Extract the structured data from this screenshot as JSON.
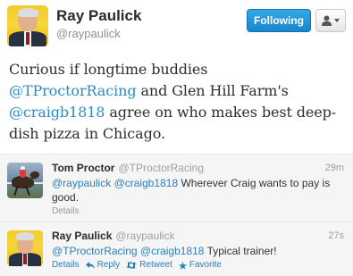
{
  "main_tweet": {
    "name": "Ray Paulick",
    "handle": "@raypaulick",
    "follow_label": "Following",
    "text_lines": [
      [
        {
          "t": "Curious if longtime buddies",
          "m": false
        }
      ],
      [
        {
          "t": "@TProctorRacing",
          "m": true
        },
        {
          "t": " and Glen Hill Farm's",
          "m": false
        }
      ],
      [
        {
          "t": "@craigb1818",
          "m": true
        },
        {
          "t": " agree on who makes best deep-",
          "m": false
        }
      ],
      [
        {
          "t": "dish pizza in Chicago.",
          "m": false
        }
      ]
    ]
  },
  "replies": [
    {
      "name": "Tom Proctor",
      "handle": "@TProctorRacing",
      "time": "29m",
      "mentions": [
        "@raypaulick",
        "@craigb1818"
      ],
      "text": "Wherever Craig wants to pay is good.",
      "details": "Details"
    },
    {
      "name": "Ray Paulick",
      "handle": "@raypaulick",
      "time": "27s",
      "mentions": [
        "@TProctorRacing",
        "@craigb1818"
      ],
      "text": "Typical trainer!",
      "actions": {
        "details": "Details",
        "reply": "Reply",
        "retweet": "Retweet",
        "favorite": "Favorite"
      }
    }
  ],
  "colors": {
    "link": "#2a8cc4",
    "follow_button": "#1986cc",
    "reply_background": "#f5f5f5"
  },
  "icons": [
    "user-menu-icon",
    "chevron-down-icon",
    "reply-icon",
    "retweet-icon",
    "favorite-star-icon"
  ]
}
